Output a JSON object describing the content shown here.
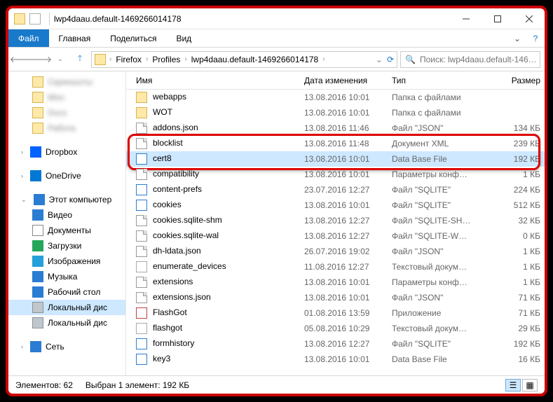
{
  "window": {
    "title": "lwp4daau.default-1469266014178"
  },
  "ribbon": {
    "tabs": {
      "file": "Файл",
      "home": "Главная",
      "share": "Поделиться",
      "view": "Вид"
    }
  },
  "nav": {
    "breadcrumbs": [
      "Firefox",
      "Profiles",
      "lwp4daau.default-1469266014178"
    ],
    "search_placeholder": "Поиск: lwp4daau.default-146…"
  },
  "sidebar": {
    "blurred": [
      "Скриншоты",
      "Misc",
      "Docs",
      "Работа"
    ],
    "dropbox": "Dropbox",
    "onedrive": "OneDrive",
    "this_pc": "Этот компьютер",
    "videos": "Видео",
    "documents": "Документы",
    "downloads": "Загрузки",
    "pictures": "Изображения",
    "music": "Музыка",
    "desktop": "Рабочий стол",
    "local_disk": "Локальный дис",
    "local_disk2": "Локальный дис",
    "network": "Сеть"
  },
  "columns": {
    "name": "Имя",
    "date": "Дата изменения",
    "type": "Тип",
    "size": "Размер"
  },
  "files": [
    {
      "icon": "folder",
      "name": "webapps",
      "date": "13.08.2016 10:01",
      "type": "Папка с файлами",
      "size": ""
    },
    {
      "icon": "folder",
      "name": "WOT",
      "date": "13.08.2016 10:01",
      "type": "Папка с файлами",
      "size": ""
    },
    {
      "icon": "file",
      "name": "addons.json",
      "date": "13.08.2016 11:46",
      "type": "Файл \"JSON\"",
      "size": "134 КБ"
    },
    {
      "icon": "file",
      "name": "blocklist",
      "date": "13.08.2016 11:48",
      "type": "Документ XML",
      "size": "239 КБ"
    },
    {
      "icon": "db",
      "name": "cert8",
      "date": "13.08.2016 10:01",
      "type": "Data Base File",
      "size": "192 КБ",
      "selected": true
    },
    {
      "icon": "file",
      "name": "compatibility",
      "date": "13.08.2016 10:01",
      "type": "Параметры конф…",
      "size": "1 КБ"
    },
    {
      "icon": "db",
      "name": "content-prefs",
      "date": "23.07.2016 12:27",
      "type": "Файл \"SQLITE\"",
      "size": "224 КБ"
    },
    {
      "icon": "db",
      "name": "cookies",
      "date": "13.08.2016 10:01",
      "type": "Файл \"SQLITE\"",
      "size": "512 КБ"
    },
    {
      "icon": "file",
      "name": "cookies.sqlite-shm",
      "date": "13.08.2016 12:27",
      "type": "Файл \"SQLITE-SH…",
      "size": "32 КБ"
    },
    {
      "icon": "file",
      "name": "cookies.sqlite-wal",
      "date": "13.08.2016 12:27",
      "type": "Файл \"SQLITE-W…",
      "size": "0 КБ"
    },
    {
      "icon": "file",
      "name": "dh-ldata.json",
      "date": "26.07.2016 19:02",
      "type": "Файл \"JSON\"",
      "size": "1 КБ"
    },
    {
      "icon": "txt",
      "name": "enumerate_devices",
      "date": "11.08.2016 12:27",
      "type": "Текстовый докум…",
      "size": "1 КБ"
    },
    {
      "icon": "file",
      "name": "extensions",
      "date": "13.08.2016 10:01",
      "type": "Параметры конф…",
      "size": "1 КБ"
    },
    {
      "icon": "file",
      "name": "extensions.json",
      "date": "13.08.2016 10:01",
      "type": "Файл \"JSON\"",
      "size": "71 КБ"
    },
    {
      "icon": "exe",
      "name": "FlashGot",
      "date": "01.08.2016 13:59",
      "type": "Приложение",
      "size": "71 КБ"
    },
    {
      "icon": "txt",
      "name": "flashgot",
      "date": "05.08.2016 10:29",
      "type": "Текстовый докум…",
      "size": "29 КБ"
    },
    {
      "icon": "db",
      "name": "formhistory",
      "date": "13.08.2016 12:27",
      "type": "Файл \"SQLITE\"",
      "size": "192 КБ"
    },
    {
      "icon": "db",
      "name": "key3",
      "date": "13.08.2016 10:01",
      "type": "Data Base File",
      "size": "16 КБ"
    }
  ],
  "statusbar": {
    "count": "Элементов: 62",
    "selection": "Выбран 1 элемент: 192 КБ"
  }
}
